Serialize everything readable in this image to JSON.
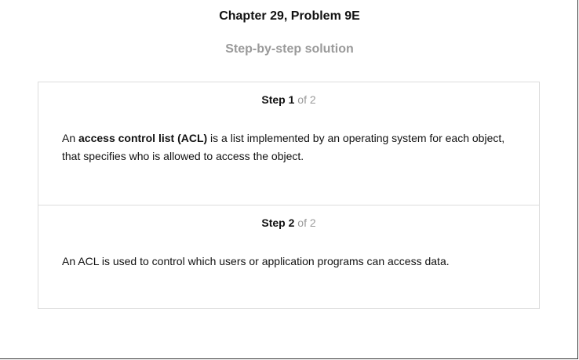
{
  "header": {
    "title": "Chapter 29, Problem 9E",
    "subtitle": "Step-by-step solution"
  },
  "steps": [
    {
      "label": "Step",
      "number": "1",
      "of": "of 2",
      "text_before": "An ",
      "text_bold": "access control list (ACL)",
      "text_after": " is a list implemented by an operating system for each object, that specifies who is allowed to access the object."
    },
    {
      "label": "Step",
      "number": "2",
      "of": "of 2",
      "text": "An ACL is used to control which users or application programs can access data."
    }
  ]
}
